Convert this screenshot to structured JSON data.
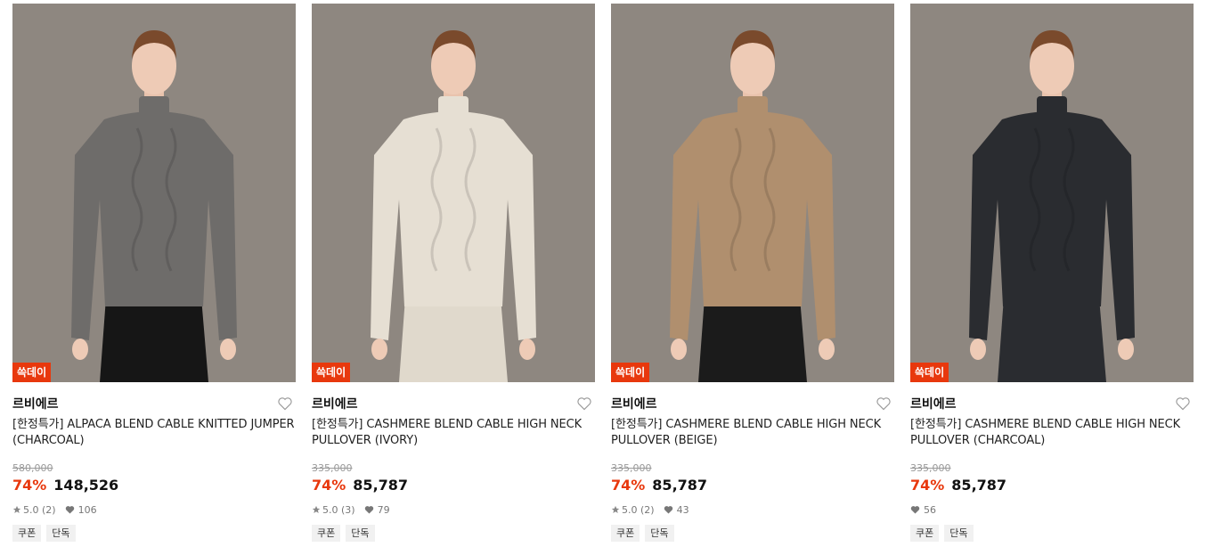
{
  "colors": {
    "accent": "#e8380d",
    "photo_bg": "#8e8780"
  },
  "products": [
    {
      "badge": "쓱데이",
      "brand": "르비에르",
      "title": "[한정특가] ALPACA BLEND CABLE KNITTED JUMPER (CHARCOAL)",
      "original_price": "580,000",
      "discount": "74%",
      "price": "148,526",
      "rating": "5.0 (2)",
      "likes": "106",
      "tags": [
        "쿠폰",
        "단독"
      ],
      "sweater_color": "#6e6c6a",
      "bottom_color": "#161616"
    },
    {
      "badge": "쓱데이",
      "brand": "르비에르",
      "title": "[한정특가] CASHMERE BLEND CABLE HIGH NECK PULLOVER (IVORY)",
      "original_price": "335,000",
      "discount": "74%",
      "price": "85,787",
      "rating": "5.0 (3)",
      "likes": "79",
      "tags": [
        "쿠폰",
        "단독"
      ],
      "sweater_color": "#e6dfd3",
      "bottom_color": "#e0d9cc"
    },
    {
      "badge": "쓱데이",
      "brand": "르비에르",
      "title": "[한정특가] CASHMERE BLEND CABLE HIGH NECK PULLOVER (BEIGE)",
      "original_price": "335,000",
      "discount": "74%",
      "price": "85,787",
      "rating": "5.0 (2)",
      "likes": "43",
      "tags": [
        "쿠폰",
        "단독"
      ],
      "sweater_color": "#b08f6e",
      "bottom_color": "#1b1b1b"
    },
    {
      "badge": "쓱데이",
      "brand": "르비에르",
      "title": "[한정특가] CASHMERE BLEND CABLE HIGH NECK PULLOVER (CHARCOAL)",
      "original_price": "335,000",
      "discount": "74%",
      "price": "85,787",
      "rating": "",
      "likes": "56",
      "tags": [
        "쿠폰",
        "단독"
      ],
      "sweater_color": "#2a2c30",
      "bottom_color": "#2a2c30"
    }
  ]
}
